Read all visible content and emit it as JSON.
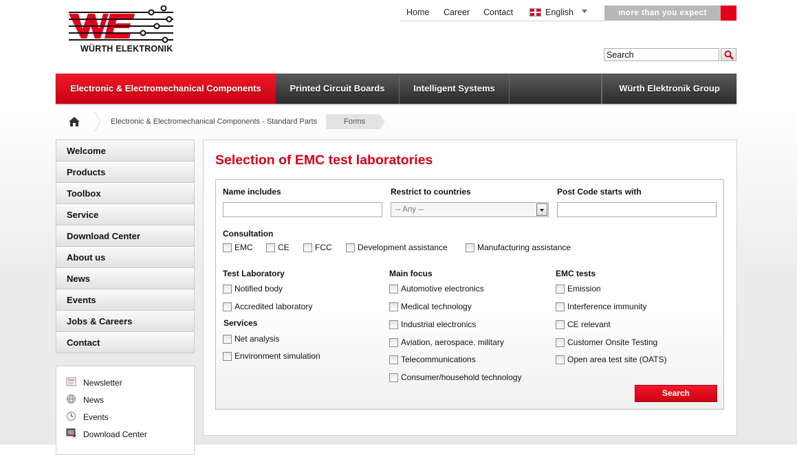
{
  "header": {
    "logo_text": "WÜRTH ELEKTRONIK",
    "links": [
      "Home",
      "Career",
      "Contact"
    ],
    "language": "English",
    "tagline": "more than you expect",
    "search_value": "Search"
  },
  "mainnav": [
    "Electronic & Electromechanical Components",
    "Printed Circuit Boards",
    "Intelligent Systems",
    "",
    "Würth Elektronik Group"
  ],
  "breadcrumb": {
    "items": [
      "Electronic & Electromechanical Components - Standard Parts"
    ],
    "current": "Forms"
  },
  "sidebar": {
    "menu": [
      "Welcome",
      "Products",
      "Toolbox",
      "Service",
      "Download Center",
      "About us",
      "News",
      "Events",
      "Jobs & Careers",
      "Contact"
    ],
    "links": [
      "Newsletter",
      "News",
      "Events",
      "Download Center"
    ]
  },
  "main": {
    "title": "Selection of EMC test laboratories",
    "form": {
      "name_label": "Name includes",
      "name_value": "",
      "country_label": "Restrict to countries",
      "country_value": "-- Any --",
      "postcode_label": "Post Code starts with",
      "postcode_value": "",
      "consultation_label": "Consultation",
      "consultation": [
        "EMC",
        "CE",
        "FCC",
        "Development assistance",
        "Manufacturing assistance"
      ],
      "test_lab_label": "Test Laboratory",
      "test_lab": [
        "Notified body",
        "Accredited laboratory"
      ],
      "services_label": "Services",
      "services": [
        "Net analysis",
        "Environment simulation"
      ],
      "main_focus_label": "Main focus",
      "main_focus": [
        "Automotive electronics",
        "Medical technology",
        "Industrial electronics",
        "Aviation, aerospace, military",
        "Telecommunications",
        "Consumer/household technology"
      ],
      "emc_tests_label": "EMC tests",
      "emc_tests": [
        "Emission",
        "Interference immunity",
        "CE relevant",
        "Customer Onsite Testing",
        "Open area test site (OATS)"
      ],
      "submit_label": "Search"
    }
  },
  "colors": {
    "brand_red": "#e2001a",
    "title_red": "#d4001b",
    "nav_dark": "#2b2b2b"
  },
  "icons": [
    "home-icon",
    "magnifier-icon",
    "newsletter-icon",
    "news-globe-icon",
    "events-clock-icon",
    "download-icon"
  ]
}
